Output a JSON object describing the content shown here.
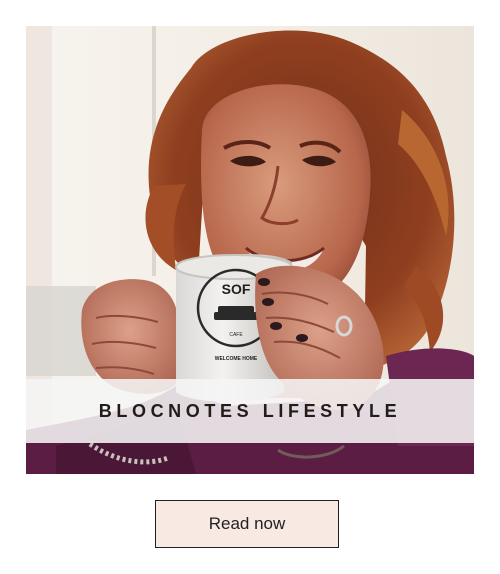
{
  "card": {
    "title": "BLOCNOTES LIFESTYLE",
    "button_label": "Read now",
    "photo": {
      "mug_text": "SOF",
      "mug_subtext": "CAFE",
      "mug_footer": "WELCOME HOME"
    }
  },
  "colors": {
    "title_band": "#f5f5f5",
    "title_text": "#231c1a",
    "button_bg": "#f8e9e3",
    "button_border": "#1f1f1f",
    "hair": "#8b3b1e",
    "sweater": "#5b1d43"
  }
}
